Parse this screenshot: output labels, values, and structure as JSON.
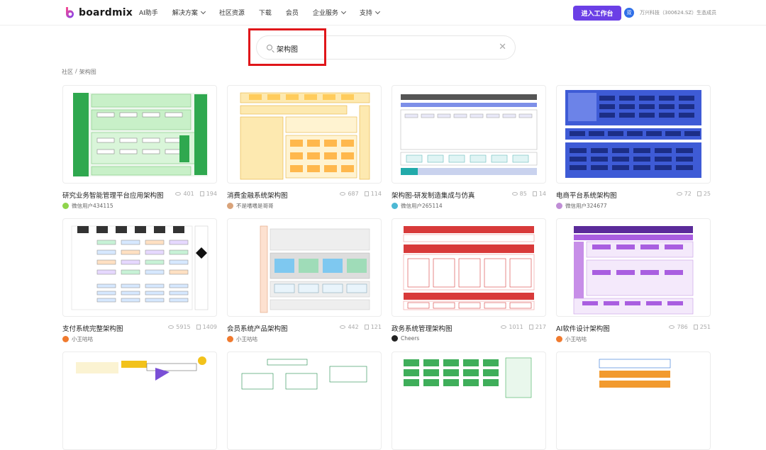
{
  "header": {
    "logo_text": "boardmix",
    "nav": [
      {
        "label": "AI助手",
        "dropdown": false
      },
      {
        "label": "解决方案",
        "dropdown": true
      },
      {
        "label": "社区资源",
        "dropdown": false
      },
      {
        "label": "下载",
        "dropdown": false
      },
      {
        "label": "会员",
        "dropdown": false
      },
      {
        "label": "企业服务",
        "dropdown": true
      },
      {
        "label": "支持",
        "dropdown": true
      }
    ],
    "cta_label": "进入工作台",
    "partner_badge": "双",
    "partner_text": "万兴科技（300624.SZ）生态成员",
    "brand_color": "#6b3fe6"
  },
  "search": {
    "value": "架构图",
    "placeholder": ""
  },
  "breadcrumb": {
    "home": "社区",
    "separator": "/",
    "current": "架构图"
  },
  "cards": [
    {
      "title": "研究业务智能管理平台应用架构图",
      "views": "401",
      "copies": "194",
      "author": "微信用户434115",
      "avatar_color": "#8fd44c",
      "thumb": "green"
    },
    {
      "title": "消费金融系统架构图",
      "views": "687",
      "copies": "114",
      "author": "不是嗜嗜是哥哥",
      "avatar_color": "#d9a37a",
      "thumb": "yellow"
    },
    {
      "title": "架构图-研发制造集成与仿真",
      "views": "85",
      "copies": "14",
      "author": "微信用户265114",
      "avatar_color": "#4cb8d4",
      "thumb": "grid"
    },
    {
      "title": "电商平台系统架构图",
      "views": "72",
      "copies": "25",
      "author": "微信用户324677",
      "avatar_color": "#c08ed6",
      "thumb": "blue"
    },
    {
      "title": "支付系统完整架构图",
      "views": "5915",
      "copies": "1409",
      "author": "小王咕咕",
      "avatar_color": "#f07a2e",
      "thumb": "pay"
    },
    {
      "title": "会员系统产品架构图",
      "views": "442",
      "copies": "121",
      "author": "小王咕咕",
      "avatar_color": "#f07a2e",
      "thumb": "member"
    },
    {
      "title": "政务系统管理架构图",
      "views": "1011",
      "copies": "217",
      "author": "Cheers",
      "avatar_color": "#222222",
      "thumb": "red"
    },
    {
      "title": "AI软件设计架构图",
      "views": "786",
      "copies": "251",
      "author": "小王咕咕",
      "avatar_color": "#f07a2e",
      "thumb": "purple"
    },
    {
      "title": "",
      "views": "",
      "copies": "",
      "author": "",
      "avatar_color": "#f07a2e",
      "thumb": "mindmap"
    },
    {
      "title": "",
      "views": "",
      "copies": "",
      "author": "",
      "avatar_color": "#f07a2e",
      "thumb": "flow"
    },
    {
      "title": "",
      "views": "",
      "copies": "",
      "author": "",
      "avatar_color": "#f07a2e",
      "thumb": "greengrid"
    },
    {
      "title": "",
      "views": "",
      "copies": "",
      "author": "",
      "avatar_color": "#f07a2e",
      "thumb": "orange"
    }
  ]
}
